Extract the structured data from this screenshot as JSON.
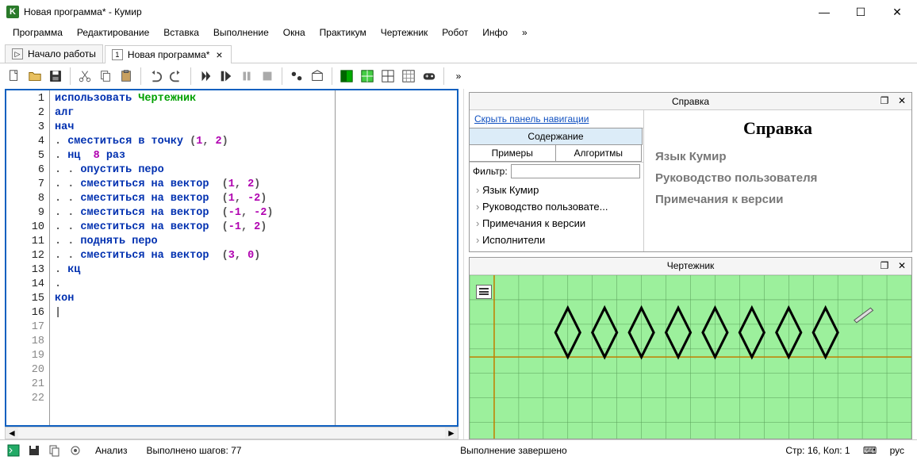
{
  "window": {
    "icon_letter": "K",
    "title": "Новая программа* - Кумир"
  },
  "menu": [
    "Программа",
    "Редактирование",
    "Вставка",
    "Выполнение",
    "Окна",
    "Практикум",
    "Чертежник",
    "Робот",
    "Инфо",
    "»"
  ],
  "tabs": [
    {
      "label": "Начало работы",
      "close": false,
      "active": false,
      "badge": "▷"
    },
    {
      "label": "Новая программа*",
      "close": true,
      "active": true,
      "badge": "1"
    }
  ],
  "editor": {
    "lines_total": 22,
    "active_max": 16,
    "code": [
      [
        {
          "t": "использовать ",
          "c": "kw"
        },
        {
          "t": "Чертежник",
          "c": "ident"
        }
      ],
      [
        {
          "t": "алг",
          "c": "kw"
        }
      ],
      [
        {
          "t": "нач",
          "c": "kw"
        }
      ],
      [
        {
          "t": ". ",
          "c": "punc"
        },
        {
          "t": "сместиться в точку",
          "c": "kw"
        },
        {
          "t": " (",
          "c": "punc"
        },
        {
          "t": "1",
          "c": "num"
        },
        {
          "t": ", ",
          "c": "punc"
        },
        {
          "t": "2",
          "c": "num"
        },
        {
          "t": ")",
          "c": "punc"
        }
      ],
      [
        {
          "t": ". ",
          "c": "punc"
        },
        {
          "t": "нц",
          "c": "kw"
        },
        {
          "t": "  ",
          "c": ""
        },
        {
          "t": "8",
          "c": "num"
        },
        {
          "t": " ",
          "c": ""
        },
        {
          "t": "раз",
          "c": "kw"
        }
      ],
      [
        {
          "t": ". . ",
          "c": "punc"
        },
        {
          "t": "опустить перо",
          "c": "kw"
        }
      ],
      [
        {
          "t": ". . ",
          "c": "punc"
        },
        {
          "t": "сместиться на вектор",
          "c": "kw"
        },
        {
          "t": "  (",
          "c": "punc"
        },
        {
          "t": "1",
          "c": "num"
        },
        {
          "t": ", ",
          "c": "punc"
        },
        {
          "t": "2",
          "c": "num"
        },
        {
          "t": ")",
          "c": "punc"
        }
      ],
      [
        {
          "t": ". . ",
          "c": "punc"
        },
        {
          "t": "сместиться на вектор",
          "c": "kw"
        },
        {
          "t": "  (",
          "c": "punc"
        },
        {
          "t": "1",
          "c": "num"
        },
        {
          "t": ", ",
          "c": "punc"
        },
        {
          "t": "-2",
          "c": "num"
        },
        {
          "t": ")",
          "c": "punc"
        }
      ],
      [
        {
          "t": ". . ",
          "c": "punc"
        },
        {
          "t": "сместиться на вектор",
          "c": "kw"
        },
        {
          "t": "  (",
          "c": "punc"
        },
        {
          "t": "-1",
          "c": "num"
        },
        {
          "t": ", ",
          "c": "punc"
        },
        {
          "t": "-2",
          "c": "num"
        },
        {
          "t": ")",
          "c": "punc"
        }
      ],
      [
        {
          "t": ". . ",
          "c": "punc"
        },
        {
          "t": "сместиться на вектор",
          "c": "kw"
        },
        {
          "t": "  (",
          "c": "punc"
        },
        {
          "t": "-1",
          "c": "num"
        },
        {
          "t": ", ",
          "c": "punc"
        },
        {
          "t": "2",
          "c": "num"
        },
        {
          "t": ")",
          "c": "punc"
        }
      ],
      [
        {
          "t": ". . ",
          "c": "punc"
        },
        {
          "t": "поднять перо",
          "c": "kw"
        }
      ],
      [
        {
          "t": ". . ",
          "c": "punc"
        },
        {
          "t": "сместиться на вектор",
          "c": "kw"
        },
        {
          "t": "  (",
          "c": "punc"
        },
        {
          "t": "3",
          "c": "num"
        },
        {
          "t": ", ",
          "c": "punc"
        },
        {
          "t": "0",
          "c": "num"
        },
        {
          "t": ")",
          "c": "punc"
        }
      ],
      [
        {
          "t": ". ",
          "c": "punc"
        },
        {
          "t": "кц",
          "c": "kw"
        }
      ],
      [
        {
          "t": ".",
          "c": "punc"
        }
      ],
      [
        {
          "t": "кон",
          "c": "kw"
        }
      ],
      [
        {
          "t": "|",
          "c": ""
        }
      ]
    ]
  },
  "help_panel": {
    "title": "Справка",
    "hide_nav": "Скрыть панель навигации",
    "tabs": {
      "contents": "Содержание",
      "examples": "Примеры",
      "algos": "Алгоритмы"
    },
    "filter_label": "Фильтр:",
    "tree": [
      "Язык Кумир",
      "Руководство пользовате...",
      "Примечания к версии",
      "Исполнители"
    ],
    "content_title": "Справка",
    "sections": [
      "Язык Кумир",
      "Руководство пользователя",
      "Примечания к версии"
    ]
  },
  "draw_panel": {
    "title": "Чертежник"
  },
  "status": {
    "analysis": "Анализ",
    "steps": "Выполнено шагов: 77",
    "state": "Выполнение завершено",
    "pos": "Стр: 16, Кол: 1",
    "lang": "рус"
  }
}
